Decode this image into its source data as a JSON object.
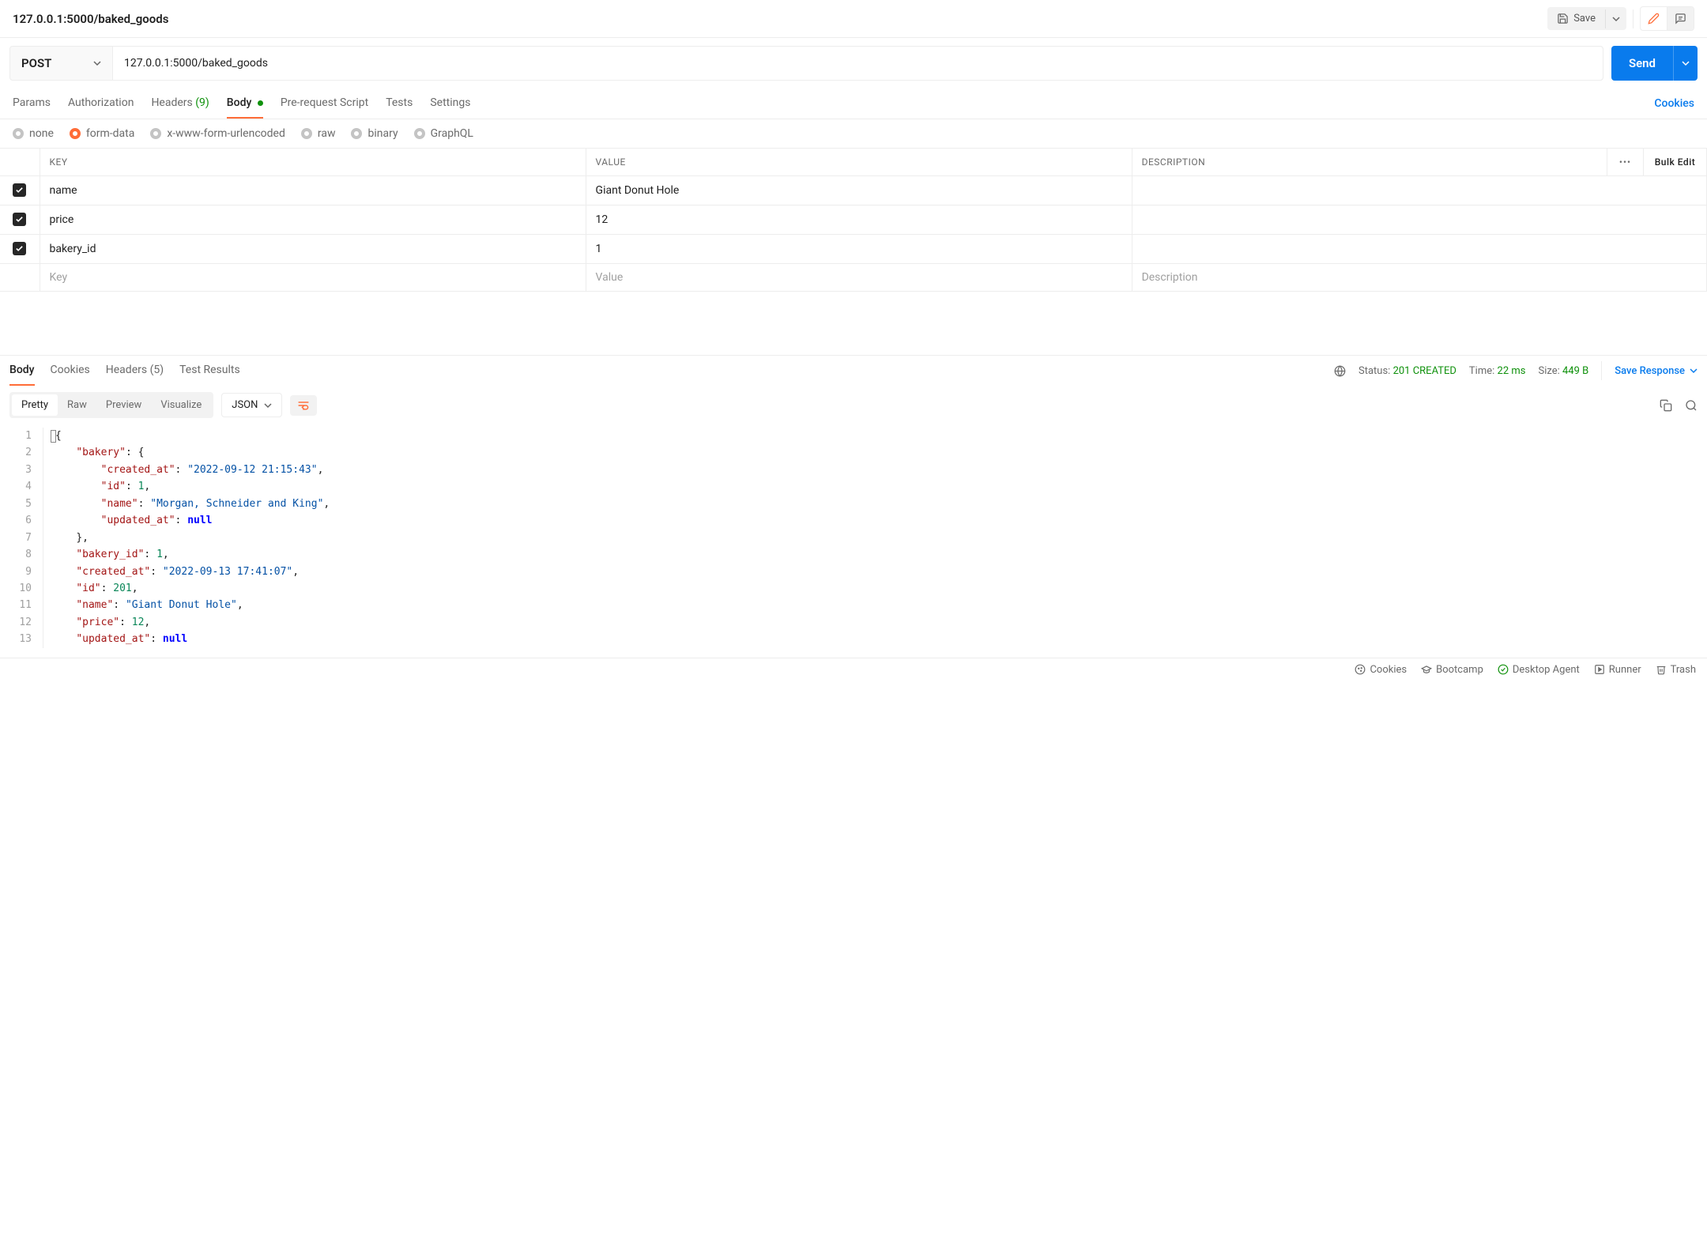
{
  "header": {
    "title": "127.0.0.1:5000/baked_goods",
    "save_label": "Save"
  },
  "request": {
    "method": "POST",
    "url": "127.0.0.1:5000/baked_goods",
    "send_label": "Send"
  },
  "request_tabs": {
    "params": "Params",
    "authorization": "Authorization",
    "headers": "Headers",
    "headers_count": "(9)",
    "body": "Body",
    "prerequest": "Pre-request Script",
    "tests": "Tests",
    "settings": "Settings",
    "cookies": "Cookies"
  },
  "body_types": {
    "none": "none",
    "formdata": "form-data",
    "urlencoded": "x-www-form-urlencoded",
    "raw": "raw",
    "binary": "binary",
    "graphql": "GraphQL"
  },
  "kv": {
    "col_key": "KEY",
    "col_value": "VALUE",
    "col_desc": "DESCRIPTION",
    "bulk": "Bulk Edit",
    "rows": [
      {
        "key": "name",
        "value": "Giant Donut Hole",
        "desc": ""
      },
      {
        "key": "price",
        "value": "12",
        "desc": ""
      },
      {
        "key": "bakery_id",
        "value": "1",
        "desc": ""
      }
    ],
    "ph_key": "Key",
    "ph_value": "Value",
    "ph_desc": "Description"
  },
  "response_tabs": {
    "body": "Body",
    "cookies": "Cookies",
    "headers": "Headers",
    "headers_count": "(5)",
    "testresults": "Test Results"
  },
  "response_meta": {
    "status_label": "Status:",
    "status_value": "201 CREATED",
    "time_label": "Time:",
    "time_value": "22 ms",
    "size_label": "Size:",
    "size_value": "449 B",
    "save_response": "Save Response"
  },
  "view_tabs": {
    "pretty": "Pretty",
    "raw": "Raw",
    "preview": "Preview",
    "visualize": "Visualize",
    "format": "JSON"
  },
  "response_body": {
    "lines": [
      {
        "n": 1,
        "indent": 0,
        "tokens": [
          {
            "t": "cursor"
          },
          {
            "t": "brace",
            "v": "{"
          }
        ]
      },
      {
        "n": 2,
        "indent": 1,
        "tokens": [
          {
            "t": "key",
            "v": "\"bakery\""
          },
          {
            "t": "brace",
            "v": ": {"
          }
        ]
      },
      {
        "n": 3,
        "indent": 2,
        "tokens": [
          {
            "t": "key",
            "v": "\"created_at\""
          },
          {
            "t": "brace",
            "v": ": "
          },
          {
            "t": "str",
            "v": "\"2022-09-12 21:15:43\""
          },
          {
            "t": "brace",
            "v": ","
          }
        ]
      },
      {
        "n": 4,
        "indent": 2,
        "tokens": [
          {
            "t": "key",
            "v": "\"id\""
          },
          {
            "t": "brace",
            "v": ": "
          },
          {
            "t": "num",
            "v": "1"
          },
          {
            "t": "brace",
            "v": ","
          }
        ]
      },
      {
        "n": 5,
        "indent": 2,
        "tokens": [
          {
            "t": "key",
            "v": "\"name\""
          },
          {
            "t": "brace",
            "v": ": "
          },
          {
            "t": "str",
            "v": "\"Morgan, Schneider and King\""
          },
          {
            "t": "brace",
            "v": ","
          }
        ]
      },
      {
        "n": 6,
        "indent": 2,
        "tokens": [
          {
            "t": "key",
            "v": "\"updated_at\""
          },
          {
            "t": "brace",
            "v": ": "
          },
          {
            "t": "null",
            "v": "null"
          }
        ]
      },
      {
        "n": 7,
        "indent": 1,
        "tokens": [
          {
            "t": "brace",
            "v": "},"
          }
        ]
      },
      {
        "n": 8,
        "indent": 1,
        "tokens": [
          {
            "t": "key",
            "v": "\"bakery_id\""
          },
          {
            "t": "brace",
            "v": ": "
          },
          {
            "t": "num",
            "v": "1"
          },
          {
            "t": "brace",
            "v": ","
          }
        ]
      },
      {
        "n": 9,
        "indent": 1,
        "tokens": [
          {
            "t": "key",
            "v": "\"created_at\""
          },
          {
            "t": "brace",
            "v": ": "
          },
          {
            "t": "str",
            "v": "\"2022-09-13 17:41:07\""
          },
          {
            "t": "brace",
            "v": ","
          }
        ]
      },
      {
        "n": 10,
        "indent": 1,
        "tokens": [
          {
            "t": "key",
            "v": "\"id\""
          },
          {
            "t": "brace",
            "v": ": "
          },
          {
            "t": "num",
            "v": "201"
          },
          {
            "t": "brace",
            "v": ","
          }
        ]
      },
      {
        "n": 11,
        "indent": 1,
        "tokens": [
          {
            "t": "key",
            "v": "\"name\""
          },
          {
            "t": "brace",
            "v": ": "
          },
          {
            "t": "str",
            "v": "\"Giant Donut Hole\""
          },
          {
            "t": "brace",
            "v": ","
          }
        ]
      },
      {
        "n": 12,
        "indent": 1,
        "tokens": [
          {
            "t": "key",
            "v": "\"price\""
          },
          {
            "t": "brace",
            "v": ": "
          },
          {
            "t": "num",
            "v": "12"
          },
          {
            "t": "brace",
            "v": ","
          }
        ]
      },
      {
        "n": 13,
        "indent": 1,
        "tokens": [
          {
            "t": "key",
            "v": "\"updated_at\""
          },
          {
            "t": "brace",
            "v": ": "
          },
          {
            "t": "null",
            "v": "null"
          }
        ]
      }
    ]
  },
  "footer": {
    "cookies": "Cookies",
    "bootcamp": "Bootcamp",
    "desktop": "Desktop Agent",
    "runner": "Runner",
    "trash": "Trash"
  }
}
